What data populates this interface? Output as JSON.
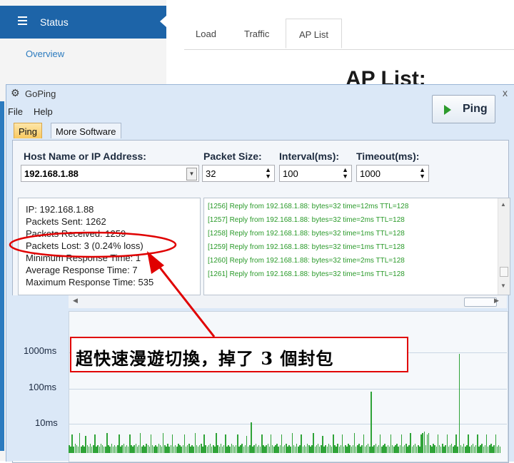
{
  "router": {
    "status_label": "Status",
    "overview_label": "Overview",
    "tabs": [
      "Load",
      "Traffic",
      "AP List"
    ],
    "heading": "AP List:"
  },
  "goping": {
    "title": "GoPing",
    "menu": [
      "File",
      "Help"
    ],
    "tabs": [
      "Ping",
      "More Software"
    ],
    "host_label": "Host Name or IP Address:",
    "host_value": "192.168.1.88",
    "packet_size_label": "Packet Size:",
    "packet_size_value": "32",
    "interval_label": "Interval(ms):",
    "interval_value": "100",
    "timeout_label": "Timeout(ms):",
    "timeout_value": "1000",
    "ping_button": "Ping",
    "stats": [
      "IP: 192.168.1.88",
      "Packets Sent: 1262",
      "Packets Received: 1259",
      "Packets Lost: 3 (0.24% loss)",
      "Minimum Response Time: 1",
      "Average Response Time: 7",
      "Maximum Response Time: 535"
    ],
    "log": [
      "[1256] Reply from 192.168.1.88: bytes=32 time=12ms TTL=128",
      "[1257] Reply from 192.168.1.88: bytes=32 time=2ms TTL=128",
      "[1258] Reply from 192.168.1.88: bytes=32 time=1ms TTL=128",
      "[1259] Reply from 192.168.1.88: bytes=32 time=1ms TTL=128",
      "[1260] Reply from 192.168.1.88: bytes=32 time=2ms TTL=128",
      "[1261] Reply from 192.168.1.88: bytes=32 time=1ms TTL=128"
    ],
    "graph_labels": [
      "1000ms",
      "100ms",
      "10ms"
    ],
    "bar_levels": [
      0.05,
      0.04,
      0.12,
      0.04,
      0.06,
      0.05,
      0.04,
      0.13,
      0.04,
      0.05,
      0.04,
      0.11,
      0.05,
      0.04,
      0.06,
      0.04,
      0.05,
      0.12,
      0.04,
      0.05,
      0.04,
      0.06,
      0.05,
      0.04,
      0.04,
      0.13,
      0.05,
      0.04,
      0.06,
      0.04,
      0.05,
      0.04,
      0.05,
      0.12,
      0.04,
      0.05,
      0.06,
      0.04,
      0.05,
      0.04,
      0.12,
      0.05,
      0.04,
      0.05,
      0.06,
      0.04,
      0.05,
      0.13,
      0.04,
      0.05,
      0.04,
      0.06,
      0.05,
      0.04,
      0.12,
      0.05,
      0.04,
      0.05,
      0.04,
      0.06,
      0.05,
      0.04,
      0.13,
      0.05,
      0.04,
      0.06,
      0.04,
      0.05,
      0.12,
      0.04,
      0.05,
      0.04,
      0.06,
      0.05,
      0.04,
      0.05,
      0.12,
      0.04,
      0.05,
      0.06,
      0.04,
      0.05,
      0.04,
      0.13,
      0.05,
      0.04,
      0.05,
      0.06,
      0.04,
      0.12,
      0.05,
      0.04,
      0.05,
      0.06,
      0.04,
      0.05,
      0.04,
      0.13,
      0.05,
      0.04,
      0.06,
      0.04,
      0.05,
      0.12,
      0.04,
      0.05,
      0.04,
      0.06,
      0.05,
      0.04,
      0.05,
      0.12,
      0.04,
      0.05,
      0.06,
      0.04,
      0.05,
      0.11,
      0.04,
      0.05,
      0.2,
      0.04,
      0.05,
      0.06,
      0.04,
      0.05,
      0.04,
      0.12,
      0.05,
      0.04,
      0.05,
      0.06,
      0.04,
      0.12,
      0.05,
      0.04,
      0.05,
      0.06,
      0.04,
      0.05,
      0.12,
      0.04,
      0.05,
      0.06,
      0.04,
      0.05,
      0.04,
      0.13,
      0.05,
      0.04,
      0.06,
      0.04,
      0.05,
      0.12,
      0.04,
      0.05,
      0.04,
      0.06,
      0.05,
      0.04,
      0.05,
      0.13,
      0.04,
      0.05,
      0.06,
      0.04,
      0.05,
      0.11,
      0.04,
      0.05,
      0.04,
      0.06,
      0.05,
      0.04,
      0.12,
      0.05,
      0.04,
      0.06,
      0.04,
      0.05,
      0.12,
      0.04,
      0.05,
      0.04,
      0.06,
      0.05,
      0.04,
      0.05,
      0.13,
      0.04,
      0.05,
      0.06,
      0.04,
      0.05,
      0.12,
      0.04,
      0.05,
      0.06,
      0.04,
      0.4,
      0.04,
      0.05,
      0.06,
      0.04,
      0.05,
      0.12,
      0.04,
      0.05,
      0.06,
      0.04,
      0.05,
      0.04,
      0.12,
      0.05,
      0.04,
      0.05,
      0.06,
      0.04,
      0.05,
      0.12,
      0.04,
      0.05,
      0.06,
      0.04,
      0.05,
      0.13,
      0.04,
      0.05,
      0.06,
      0.04,
      0.05,
      0.04,
      0.12,
      0.13,
      0.14,
      0.05,
      0.12,
      0.13,
      0.05,
      0.04,
      0.06,
      0.05,
      0.04,
      0.12,
      0.05,
      0.04,
      0.06,
      0.04,
      0.05,
      0.12,
      0.04,
      0.05,
      0.06,
      0.04,
      0.05,
      0.12,
      0.04,
      0.65,
      0.05,
      0.04,
      0.06,
      0.04,
      0.05,
      0.12,
      0.04,
      0.05,
      0.06,
      0.04,
      0.05,
      0.12,
      0.04,
      0.05,
      0.06,
      0.04,
      0.05,
      0.12,
      0.04,
      0.05,
      0.06,
      0.04,
      0.05,
      0.12,
      0.04,
      0.05,
      0.04
    ]
  },
  "annotation": {
    "callout_text": "超快速漫遊切換，掉了 3 個封包"
  },
  "colors": {
    "accent_red": "#e00000",
    "bar_green": "#2fa338",
    "log_green": "#2a9a2a",
    "router_blue": "#1d64a8"
  }
}
